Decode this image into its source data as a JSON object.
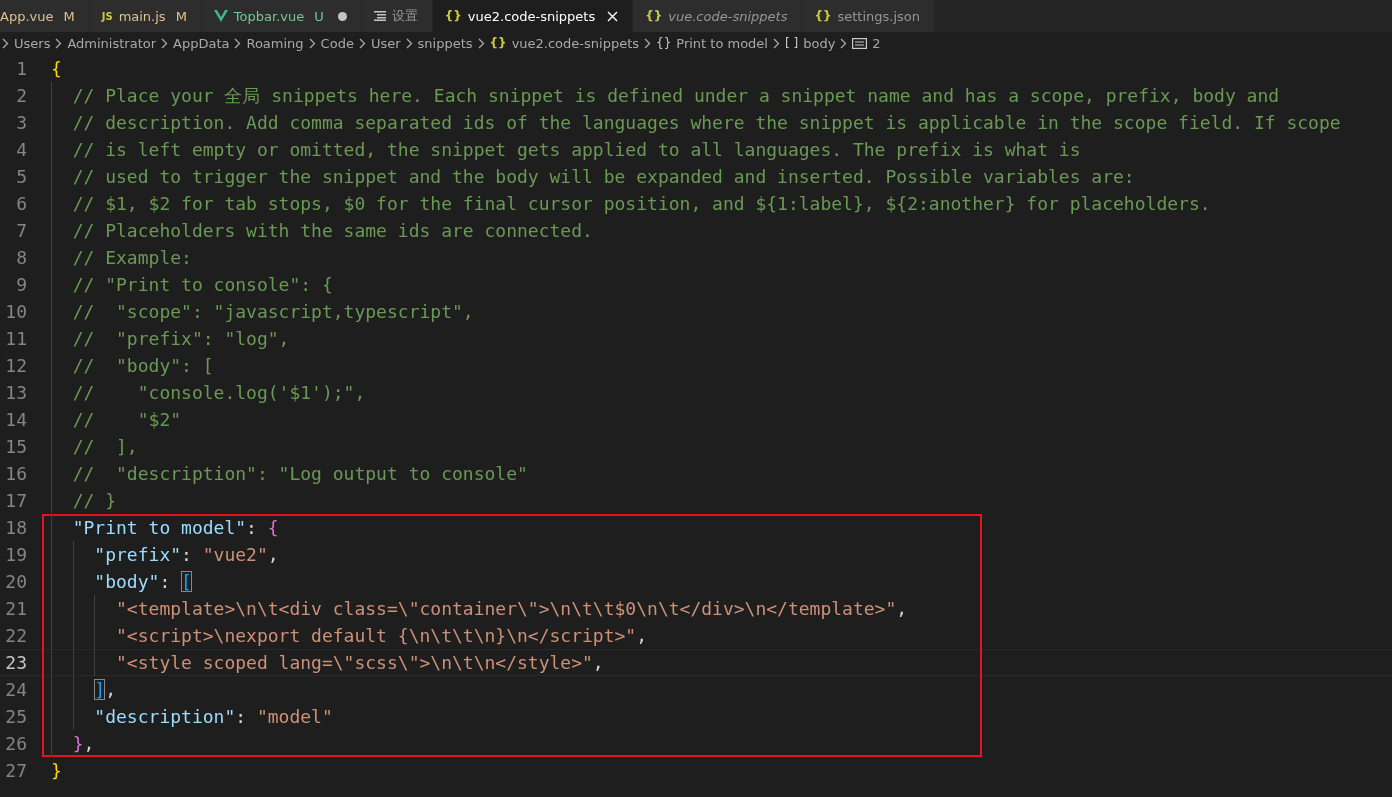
{
  "tabs": [
    {
      "label": "App.vue",
      "kind": "plain",
      "badge": "M",
      "color": "#e2c08d",
      "dirty": false,
      "italic": false,
      "selected": false
    },
    {
      "label": "main.js",
      "kind": "js",
      "icon": "JS",
      "badge": "M",
      "color": "#e2c08d",
      "dirty": false,
      "italic": false,
      "selected": false
    },
    {
      "label": "Topbar.vue",
      "kind": "vue",
      "badge": "U",
      "color": "#73c991",
      "dirty": true,
      "italic": false,
      "selected": false
    },
    {
      "label": "设置",
      "kind": "list",
      "dirty": false,
      "italic": false,
      "selected": false
    },
    {
      "label": "vue2.code-snippets",
      "kind": "braces",
      "icon": "{}",
      "dirty": false,
      "italic": false,
      "selected": true
    },
    {
      "label": "vue.code-snippets",
      "kind": "braces",
      "icon": "{}",
      "dirty": false,
      "italic": true,
      "selected": false
    },
    {
      "label": "settings.json",
      "kind": "braces",
      "icon": "{}",
      "dirty": false,
      "italic": false,
      "selected": false
    }
  ],
  "breadcrumb": [
    {
      "label": "Users",
      "kind": "folder"
    },
    {
      "label": "Administrator",
      "kind": "folder"
    },
    {
      "label": "AppData",
      "kind": "folder"
    },
    {
      "label": "Roaming",
      "kind": "folder"
    },
    {
      "label": "Code",
      "kind": "folder"
    },
    {
      "label": "User",
      "kind": "folder"
    },
    {
      "label": "snippets",
      "kind": "folder"
    },
    {
      "label": "vue2.code-snippets",
      "kind": "file",
      "icon": "{}"
    },
    {
      "label": "Print to model",
      "kind": "object",
      "icon": "{}"
    },
    {
      "label": "body",
      "kind": "array",
      "icon": "[ ]"
    },
    {
      "label": "2",
      "kind": "string"
    }
  ],
  "lines": [
    {
      "number": "1",
      "current": false,
      "highlighted": false,
      "tokens": [
        {
          "t": "{",
          "kind": "brace1"
        }
      ]
    },
    {
      "number": "2",
      "current": false,
      "highlighted": false,
      "tokens": [
        {
          "t": "  // Place your 全局 snippets here. Each snippet is defined under a snippet name and has a scope, prefix, body and",
          "kind": "comment"
        }
      ]
    },
    {
      "number": "3",
      "current": false,
      "highlighted": false,
      "tokens": [
        {
          "t": "  // description. Add comma separated ids of the languages where the snippet is applicable in the scope field. If scope",
          "kind": "comment"
        }
      ]
    },
    {
      "number": "4",
      "current": false,
      "highlighted": false,
      "tokens": [
        {
          "t": "  // is left empty or omitted, the snippet gets applied to all languages. The prefix is what is",
          "kind": "comment"
        }
      ]
    },
    {
      "number": "5",
      "current": false,
      "highlighted": false,
      "tokens": [
        {
          "t": "  // used to trigger the snippet and the body will be expanded and inserted. Possible variables are:",
          "kind": "comment"
        }
      ]
    },
    {
      "number": "6",
      "current": false,
      "highlighted": false,
      "tokens": [
        {
          "t": "  // $1, $2 for tab stops, $0 for the final cursor position, and ${1:label}, ${2:another} for placeholders.",
          "kind": "comment"
        }
      ]
    },
    {
      "number": "7",
      "current": false,
      "highlighted": false,
      "tokens": [
        {
          "t": "  // Placeholders with the same ids are connected.",
          "kind": "comment"
        }
      ]
    },
    {
      "number": "8",
      "current": false,
      "highlighted": false,
      "tokens": [
        {
          "t": "  // Example:",
          "kind": "comment"
        }
      ]
    },
    {
      "number": "9",
      "current": false,
      "highlighted": false,
      "tokens": [
        {
          "t": "  // \"Print to console\": {",
          "kind": "comment"
        }
      ]
    },
    {
      "number": "10",
      "current": false,
      "highlighted": false,
      "tokens": [
        {
          "t": "  //  \"scope\": \"javascript,typescript\",",
          "kind": "comment"
        }
      ]
    },
    {
      "number": "11",
      "current": false,
      "highlighted": false,
      "tokens": [
        {
          "t": "  //  \"prefix\": \"log\",",
          "kind": "comment"
        }
      ]
    },
    {
      "number": "12",
      "current": false,
      "highlighted": false,
      "tokens": [
        {
          "t": "  //  \"body\": [",
          "kind": "comment"
        }
      ]
    },
    {
      "number": "13",
      "current": false,
      "highlighted": false,
      "tokens": [
        {
          "t": "  //    \"console.log('$1');\",",
          "kind": "comment"
        }
      ]
    },
    {
      "number": "14",
      "current": false,
      "highlighted": false,
      "tokens": [
        {
          "t": "  //    \"$2\"",
          "kind": "comment"
        }
      ]
    },
    {
      "number": "15",
      "current": false,
      "highlighted": false,
      "tokens": [
        {
          "t": "  //  ],",
          "kind": "comment"
        }
      ]
    },
    {
      "number": "16",
      "current": false,
      "highlighted": false,
      "tokens": [
        {
          "t": "  //  \"description\": \"Log output to console\"",
          "kind": "comment"
        }
      ]
    },
    {
      "number": "17",
      "current": false,
      "highlighted": false,
      "tokens": [
        {
          "t": "  // }",
          "kind": "comment"
        }
      ]
    },
    {
      "number": "18",
      "current": false,
      "highlighted": true,
      "tokens": [
        {
          "t": "  \"Print to model\"",
          "kind": "key"
        },
        {
          "t": ": ",
          "kind": "punct"
        },
        {
          "t": "{",
          "kind": "brace2"
        }
      ]
    },
    {
      "number": "19",
      "current": false,
      "highlighted": true,
      "tokens": [
        {
          "t": "    \"prefix\"",
          "kind": "key"
        },
        {
          "t": ": ",
          "kind": "punct"
        },
        {
          "t": "\"vue2\"",
          "kind": "string"
        },
        {
          "t": ",",
          "kind": "punct"
        }
      ]
    },
    {
      "number": "20",
      "current": false,
      "highlighted": true,
      "tokens": [
        {
          "t": "    \"body\"",
          "kind": "key"
        },
        {
          "t": ": ",
          "kind": "punct"
        },
        {
          "t": "[",
          "kind": "bracket_match"
        }
      ]
    },
    {
      "number": "21",
      "current": false,
      "highlighted": true,
      "tokens": [
        {
          "t": "      \"<template>\\n\\t<div class=\\\"container\\\">\\n\\t\\t$0\\n\\t</div>\\n</template>\"",
          "kind": "string"
        },
        {
          "t": ",",
          "kind": "punct"
        }
      ]
    },
    {
      "number": "22",
      "current": false,
      "highlighted": true,
      "tokens": [
        {
          "t": "      \"<script>\\nexport default {\\n\\t\\t\\n}\\n</script>\"",
          "kind": "string"
        },
        {
          "t": ",",
          "kind": "punct"
        }
      ]
    },
    {
      "number": "23",
      "current": true,
      "highlighted": true,
      "tokens": [
        {
          "t": "      \"<style scoped lang=\\\"scss\\\">\\n\\t\\n</style>\"",
          "kind": "string"
        },
        {
          "t": ",",
          "kind": "punct"
        }
      ]
    },
    {
      "number": "24",
      "current": false,
      "highlighted": true,
      "tokens": [
        {
          "t": "    ]",
          "kind": "bracket_match"
        },
        {
          "t": ",",
          "kind": "punct"
        }
      ]
    },
    {
      "number": "25",
      "current": false,
      "highlighted": true,
      "tokens": [
        {
          "t": "    \"description\"",
          "kind": "key"
        },
        {
          "t": ": ",
          "kind": "punct"
        },
        {
          "t": "\"model\"",
          "kind": "string"
        }
      ]
    },
    {
      "number": "26",
      "current": false,
      "highlighted": true,
      "tokens": [
        {
          "t": "  }",
          "kind": "brace2"
        },
        {
          "t": ",",
          "kind": "punct"
        }
      ]
    },
    {
      "number": "27",
      "current": false,
      "highlighted": false,
      "tokens": [
        {
          "t": "}",
          "kind": "brace1"
        }
      ]
    }
  ]
}
